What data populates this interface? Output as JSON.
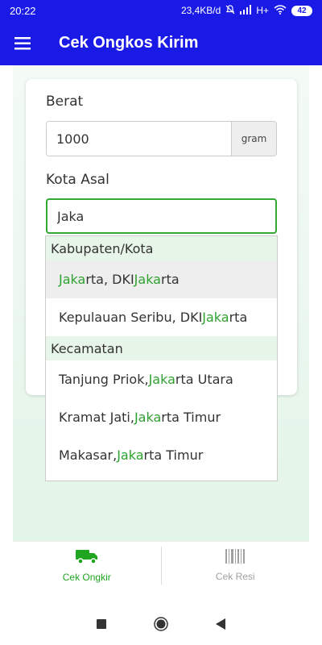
{
  "status_bar": {
    "time": "20:22",
    "network": "23,4KB/d",
    "signal": "H+",
    "battery": "42"
  },
  "app_bar": {
    "title": "Cek Ongkos Kirim",
    "menu_icon": "hamburger-menu-icon"
  },
  "form": {
    "weight_label": "Berat",
    "weight_value": "1000",
    "weight_unit": "gram",
    "origin_label": "Kota Asal",
    "origin_value": "Jaka"
  },
  "autocomplete": {
    "groups": [
      {
        "header": "Kabupaten/Kota",
        "items": [
          {
            "parts": [
              "",
              "Jaka",
              "rta, DKI ",
              "Jaka",
              "rta"
            ]
          },
          {
            "parts": [
              "Kepulauan Seribu, DKI ",
              "Jaka",
              "rta"
            ]
          }
        ]
      },
      {
        "header": "Kecamatan",
        "items": [
          {
            "parts": [
              "Tanjung Priok, ",
              "Jaka",
              "rta Utara"
            ]
          },
          {
            "parts": [
              "Kramat Jati, ",
              "Jaka",
              "rta Timur"
            ]
          },
          {
            "parts": [
              "Makasar, ",
              "Jaka",
              "rta Timur"
            ]
          }
        ]
      }
    ],
    "highlight_color": "#2fa12f"
  },
  "bottom_nav": {
    "items": [
      {
        "label": "Cek Ongkir",
        "icon": "truck-icon",
        "active": true
      },
      {
        "label": "Cek Resi",
        "icon": "barcode-icon",
        "active": false
      }
    ]
  },
  "colors": {
    "primary": "#1a1ae6",
    "accent": "#1fa51f"
  }
}
